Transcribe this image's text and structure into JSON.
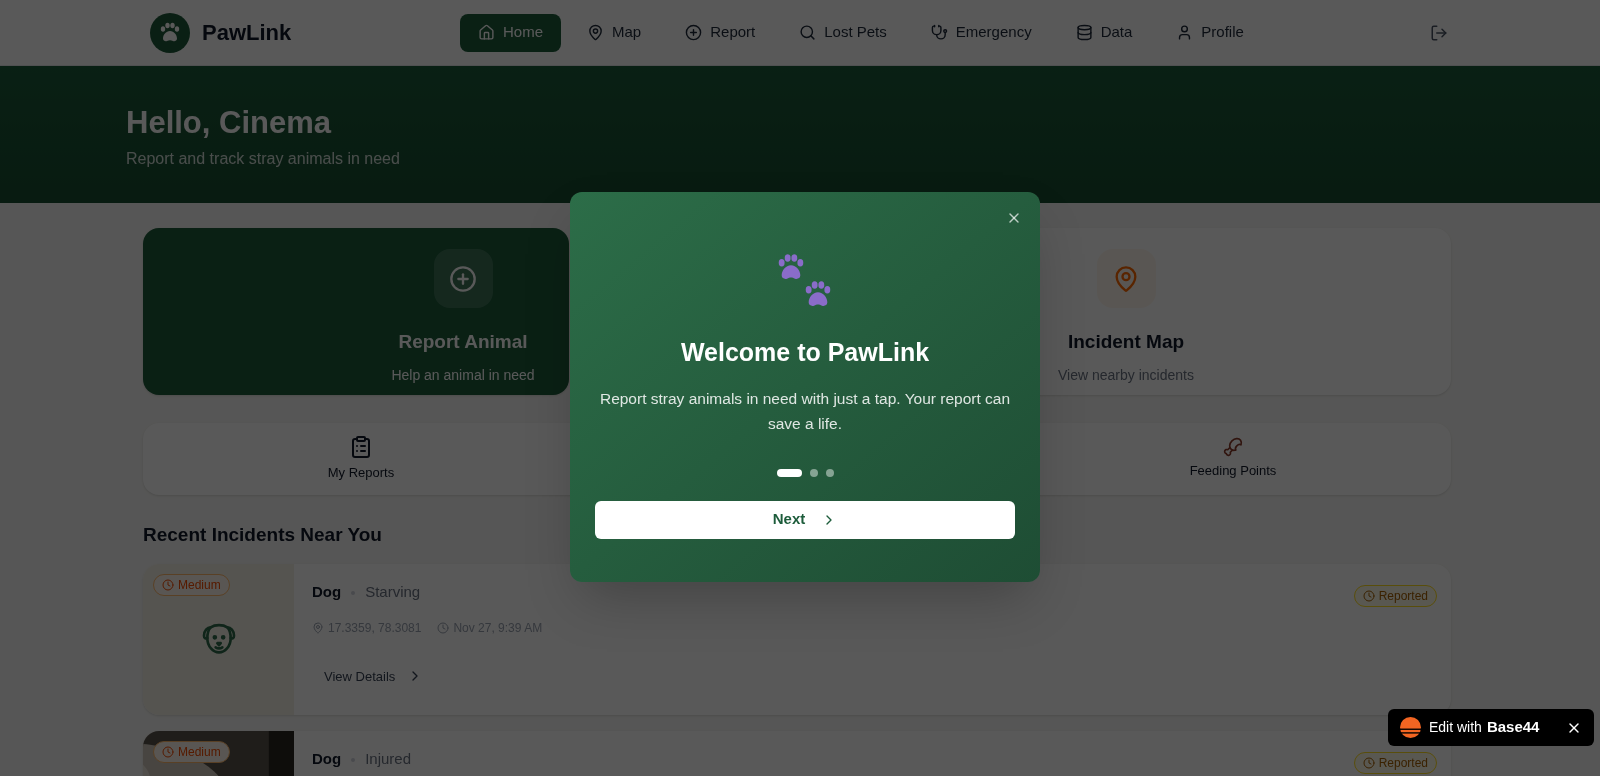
{
  "header": {
    "brand": "PawLink",
    "nav": [
      {
        "label": "Home",
        "selected": true
      },
      {
        "label": "Map",
        "selected": false
      },
      {
        "label": "Report",
        "selected": false
      },
      {
        "label": "Lost Pets",
        "selected": false
      },
      {
        "label": "Emergency",
        "selected": false
      },
      {
        "label": "Data",
        "selected": false
      },
      {
        "label": "Profile",
        "selected": false
      }
    ]
  },
  "hero": {
    "title": "Hello, Cinema",
    "subtitle": "Report and track stray animals in need"
  },
  "action_cards": [
    {
      "title": "Report Animal",
      "subtitle": "Help an animal in need",
      "kind": "primary"
    },
    {
      "title": "Incident Map",
      "subtitle": "View nearby incidents",
      "kind": "plain"
    }
  ],
  "quick_links": [
    {
      "label": "My Reports"
    },
    {
      "label": "Feeding Points"
    }
  ],
  "recent": {
    "title": "Recent Incidents Near You",
    "incidents": [
      {
        "kind": "placeholder",
        "severity": "Medium",
        "animal": "Dog",
        "condition": "Starving",
        "location": "17.3359, 78.3081",
        "time": "Nov 27, 9:39 AM",
        "action": "View Details",
        "status": "Reported"
      },
      {
        "kind": "picture",
        "severity": "Medium",
        "animal": "Dog",
        "condition": "Injured",
        "status": "Reported"
      }
    ]
  },
  "modal": {
    "title": "Welcome to PawLink",
    "text": "Report stray animals in need with just a tap. Your report can save a life.",
    "dots": [
      {
        "selected": true
      },
      {
        "selected": false
      },
      {
        "selected": false
      }
    ],
    "button": "Next"
  },
  "badge": {
    "prefix": "Edit with",
    "brand": "Base44"
  }
}
